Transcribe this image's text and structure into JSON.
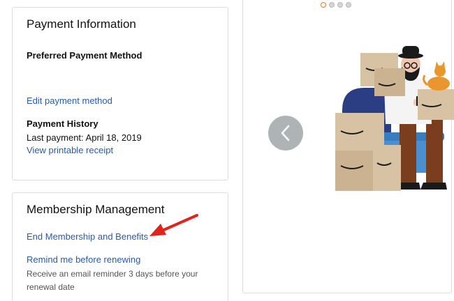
{
  "payment": {
    "title": "Payment Information",
    "preferred_label": "Preferred Payment Method",
    "edit_link": "Edit payment method",
    "history_label": "Payment History",
    "last_payment": "Last payment: April 18, 2019",
    "receipt_link": "View printable receipt"
  },
  "membership": {
    "title": "Membership Management",
    "end_link": "End Membership and Benefits",
    "remind_link": "Remind me before renewing",
    "remind_hint": "Receive an email reminder 3 days before your renewal date"
  },
  "carousel": {
    "slide_count": 4,
    "active_slide": 1,
    "prev_icon": "chevron-left-icon",
    "illustration": "man-on-couch-with-boxes-and-cat"
  },
  "colors": {
    "link": "#2a5aa8",
    "active_dot": "#e47911",
    "arrow": "#e3231b",
    "box_border": "#dddddd"
  }
}
